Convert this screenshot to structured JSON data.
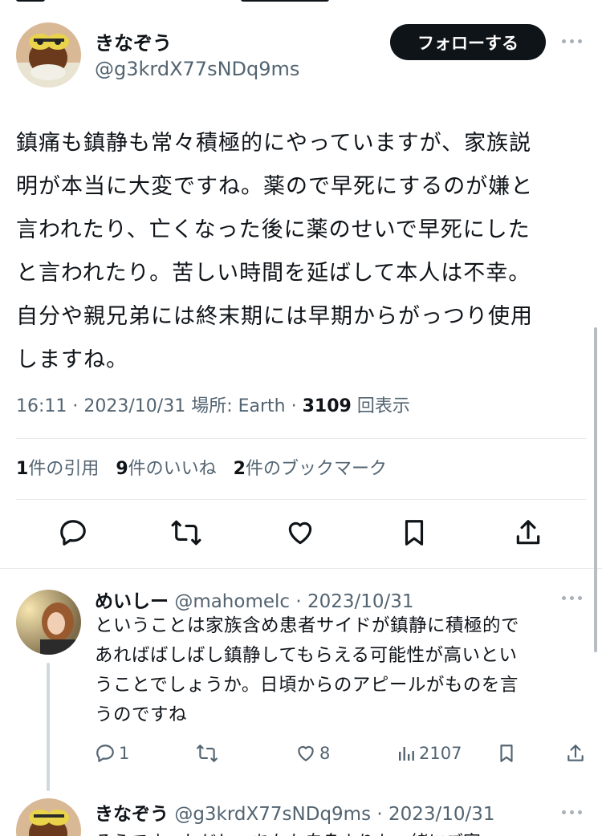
{
  "main_tweet": {
    "author_name": "きなぞう",
    "author_handle": "@g3krdX77sNDq9ms",
    "follow_label": "フォローする",
    "text_lines": [
      "鎮痛も鎮静も常々積極的にやっていますが、家族説",
      "明が本当に大変ですね。薬ので早死にするのが嫌と",
      "言われたり、亡くなった後に薬のせいで早死にした",
      "と言われたり。苦しい時間を延ばして本人は不幸。",
      "自分や親兄弟には終末期には早期からがっつり使用",
      "しますね。"
    ],
    "time": "16:11",
    "date": "2023/10/31",
    "location_label": "場所: Earth",
    "views_count": "3109",
    "views_label": "回表示",
    "stats": {
      "quotes_count": "1",
      "quotes_label": "件の引用",
      "likes_count": "9",
      "likes_label": "件のいいね",
      "bookmarks_count": "2",
      "bookmarks_label": "件のブックマーク"
    }
  },
  "reply": {
    "author_name": "めいしー",
    "author_handle": "@mahomelc",
    "date": "2023/10/31",
    "text_lines": [
      "ということは家族含め患者サイドが鎮静に積極的で",
      "あればばしばし鎮静してもらえる可能性が高いとい",
      "うことでしょうか。日頃からのアピールがものを言",
      "うのですね"
    ],
    "reply_count": "1",
    "like_count": "8",
    "view_count": "2107"
  },
  "next_reply": {
    "author_name": "きなぞう",
    "author_handle": "@g3krdX77sNDq9ms",
    "date": "2023/10/31",
    "text_partial": "そうです。ただし、あなた自身よりも一緒にご家"
  },
  "colors": {
    "text": "#0f1419",
    "secondary": "#536471",
    "divider": "#e6e9eb",
    "button_bg": "#0f1419"
  },
  "icons": [
    "reply-icon",
    "retweet-icon",
    "like-icon",
    "bookmark-icon",
    "share-icon",
    "more-icon",
    "views-icon"
  ]
}
